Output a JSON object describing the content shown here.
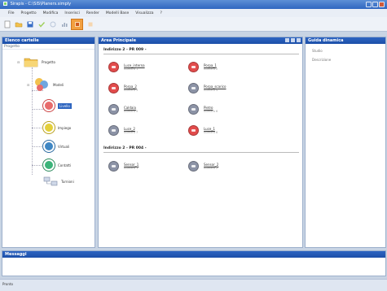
{
  "window": {
    "title": "Sirapis - C:\\SIS\\Planers.simply"
  },
  "menu": [
    "File",
    "Progetto",
    "Modifica",
    "Inserisci",
    "Render",
    "Modelli Base",
    "Visualizza",
    "?"
  ],
  "toolbar": [
    "new-file-icon",
    "open-folder-icon",
    "save-icon",
    "check-icon",
    "refresh-icon",
    "chart-icon",
    "active-tool-icon",
    "stop-icon"
  ],
  "left_panel": {
    "title": "Elenco cartelle",
    "subtitle": "Progetto",
    "root": "Progetto",
    "children": [
      {
        "label": "Modeli",
        "color": "#6fa7e0"
      },
      {
        "label": "Livello",
        "color": "#e86b6b",
        "selected": true
      },
      {
        "label": "Impiego",
        "color": "#e3cf3a"
      },
      {
        "label": "Virtuali",
        "color": "#3f87c4"
      },
      {
        "label": "Contatti",
        "color": "#3cb47a"
      },
      {
        "label": "Turnioni",
        "color": "#9aa6c2"
      }
    ]
  },
  "center_panel": {
    "title": "Area Principale",
    "groups": [
      {
        "title": "Indirizzo 2 - PR 009 -",
        "items": [
          {
            "name": "Luce_interna",
            "sub": "Numero 1",
            "color": "#e24b4b"
          },
          {
            "name": "Porpa_1",
            "sub": "Numero 2",
            "color": "#e24b4b"
          },
          {
            "name": "Porpa_2",
            "sub": "Numero 3",
            "color": "#e24b4b"
          },
          {
            "name": "Porpa_scarico",
            "sub": "Numero 4",
            "color": "#8c93a6"
          },
          {
            "name": "Caldaia",
            "sub": "Numero 5",
            "color": "#8c93a6"
          },
          {
            "name": "Pietro",
            "sub": "Numero 6",
            "color": "#8c93a6"
          },
          {
            "name": "Luce_2",
            "sub": "Numero 7",
            "color": "#8c93a6"
          },
          {
            "name": "Luce_1",
            "sub": "Numero 8",
            "color": "#e24b4b"
          }
        ]
      },
      {
        "title": "Indirizzo 2 - PR 004 -",
        "items": [
          {
            "name": "Sensor_1",
            "sub": "Numero 1",
            "color": "#8c93a6"
          },
          {
            "name": "Sensor_2",
            "sub": "Numero 2",
            "color": "#8c93a6"
          }
        ]
      }
    ]
  },
  "right_panel": {
    "title": "Guida dinamica",
    "rows": [
      "Studio",
      "Descrizione"
    ]
  },
  "bottom_panel": {
    "title": "Messaggi"
  },
  "status": {
    "text": "Pronto"
  }
}
